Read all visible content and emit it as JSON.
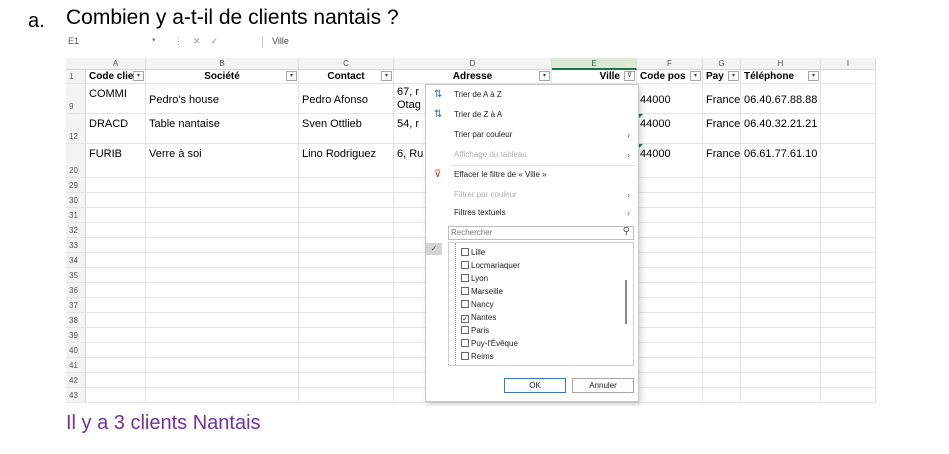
{
  "question": {
    "letter": "a.",
    "text": "Combien y a-t-il de clients nantais ?"
  },
  "answer": "Il y a 3 clients Nantais",
  "formula_bar": {
    "name_box": "E1",
    "fx": "fx",
    "value": "Ville"
  },
  "columns": [
    "A",
    "B",
    "C",
    "D",
    "E",
    "F",
    "G",
    "H",
    "I"
  ],
  "header_row": {
    "row_number": "1",
    "cells": [
      "Code clie",
      "Société",
      "Contact",
      "Adresse",
      "Ville",
      "Code pos",
      "Pay",
      "Téléphone"
    ]
  },
  "rows": [
    {
      "row_number": "9",
      "code": "COMMI",
      "societe": "Pedro's house",
      "contact": "Pedro Afonso",
      "adresse": "67, r",
      "adresse2": "Otag",
      "code_postal": "44000",
      "pays": "France",
      "telephone": "06.40.67.88.88"
    },
    {
      "row_number": "12",
      "code": "DRACD",
      "societe": "Table nantaise",
      "contact": "Sven Ottlieb",
      "adresse": "54, r",
      "adresse2": "",
      "code_postal": "44000",
      "pays": "France",
      "telephone": "06.40.32.21.21"
    },
    {
      "row_number": "20",
      "code": "FURIB",
      "societe": "Verre à soi",
      "contact": "Lino Rodriguez",
      "adresse": "6, Ru",
      "adresse2": "",
      "code_postal": "44000",
      "pays": "France",
      "telephone": "06.61.77.61.10"
    }
  ],
  "empty_rows": [
    "29",
    "30",
    "31",
    "32",
    "33",
    "34",
    "35",
    "36",
    "37",
    "38",
    "39",
    "40",
    "41",
    "42",
    "43"
  ],
  "filter_menu": {
    "sort_az": "Trier de A à Z",
    "sort_za": "Trier de Z à A",
    "sort_color": "Trier par couleur",
    "sheet_view": "Affichage du tableau",
    "clear_filter": "Effacer le filtre de « Ville »",
    "filter_color": "Filtrer par couleur",
    "text_filters": "Filtres textuels",
    "search_placeholder": "Rechercher",
    "items": [
      {
        "label": "Lille",
        "checked": false
      },
      {
        "label": "Locmariaquer",
        "checked": false
      },
      {
        "label": "Lyon",
        "checked": false
      },
      {
        "label": "Marseille",
        "checked": false
      },
      {
        "label": "Nancy",
        "checked": false
      },
      {
        "label": "Nantes",
        "checked": true
      },
      {
        "label": "Paris",
        "checked": false
      },
      {
        "label": "Puy-l'Évêque",
        "checked": false
      },
      {
        "label": "Reims",
        "checked": false
      }
    ],
    "ok_label": "OK",
    "cancel_label": "Annuler"
  },
  "colors": {
    "answer": "#7030a0",
    "excel_green": "#217346"
  }
}
